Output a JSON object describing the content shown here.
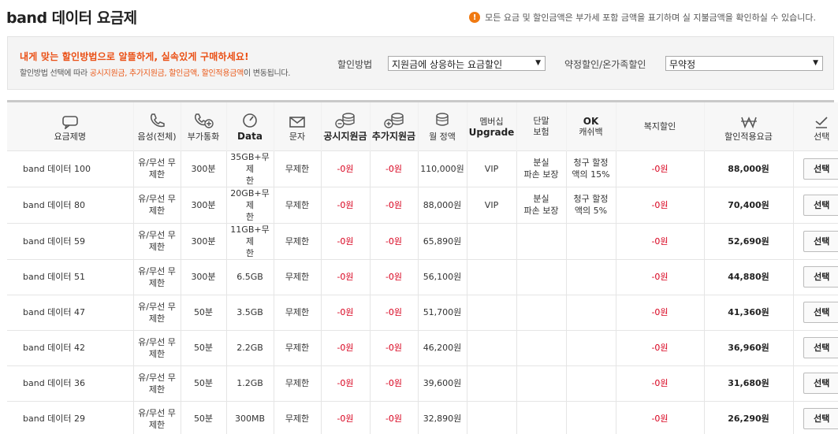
{
  "header": {
    "title": "band 데이터 요금제",
    "notice_icon": "!",
    "notice": "모든 요금 및 할인금액은 부가세 포함 금액을 표기하며 실 지불금액을 확인하실 수 있습니다."
  },
  "filter": {
    "headline": "내게 맞는 할인방법으로 알뜰하게, 실속있게 구매하세요!",
    "desc_prefix": "할인방법 선택에 따라 ",
    "desc_highlight": "공시지원금, 추가지원금, 할인금액, 할인적용금액",
    "desc_suffix": "이 변동됩니다.",
    "method_label": "할인방법",
    "method_value": "지원금에 상응하는 요금할인",
    "contract_label": "약정할인/온가족할인",
    "contract_value": "무약정"
  },
  "table": {
    "columns": {
      "plan": "요금제명",
      "voice": "음성(전체)",
      "extra_call": "부가통화",
      "data": "Data",
      "sms": "문자",
      "public_subsidy": "공시지원금",
      "extra_subsidy": "추가지원금",
      "monthly": "월 정액",
      "membership_1": "멤버십",
      "membership_2": "Upgrade",
      "insurance_1": "단말",
      "insurance_2": "보험",
      "ok_1": "OK",
      "ok_2": "캐쉬백",
      "welfare": "복지할인",
      "discount_price": "할인적용요금",
      "select": "선택"
    },
    "rows": [
      {
        "plan": "band 데이터 100",
        "voice_1": "유/무선 무",
        "voice_2": "제한",
        "extra": "300분",
        "data_1": "35GB+무제",
        "data_2": "한",
        "sms": "무제한",
        "public": "-0원",
        "extra_sub": "-0원",
        "monthly": "110,000원",
        "membership": "VIP",
        "ins_1": "분실",
        "ins_2": "파손 보장",
        "ok_1": "청구 할정",
        "ok_2": "액의 15%",
        "welfare": "-0원",
        "final": "88,000원",
        "btn": "선택"
      },
      {
        "plan": "band 데이터 80",
        "voice_1": "유/무선 무",
        "voice_2": "제한",
        "extra": "300분",
        "data_1": "20GB+무제",
        "data_2": "한",
        "sms": "무제한",
        "public": "-0원",
        "extra_sub": "-0원",
        "monthly": "88,000원",
        "membership": "VIP",
        "ins_1": "분실",
        "ins_2": "파손 보장",
        "ok_1": "청구 할정",
        "ok_2": "액의 5%",
        "welfare": "-0원",
        "final": "70,400원",
        "btn": "선택"
      },
      {
        "plan": "band 데이터 59",
        "voice_1": "유/무선 무",
        "voice_2": "제한",
        "extra": "300분",
        "data_1": "11GB+무제",
        "data_2": "한",
        "sms": "무제한",
        "public": "-0원",
        "extra_sub": "-0원",
        "monthly": "65,890원",
        "membership": "",
        "ins_1": "",
        "ins_2": "",
        "ok_1": "",
        "ok_2": "",
        "welfare": "-0원",
        "final": "52,690원",
        "btn": "선택"
      },
      {
        "plan": "band 데이터 51",
        "voice_1": "유/무선 무",
        "voice_2": "제한",
        "extra": "300분",
        "data_1": "6.5GB",
        "data_2": "",
        "sms": "무제한",
        "public": "-0원",
        "extra_sub": "-0원",
        "monthly": "56,100원",
        "membership": "",
        "ins_1": "",
        "ins_2": "",
        "ok_1": "",
        "ok_2": "",
        "welfare": "-0원",
        "final": "44,880원",
        "btn": "선택"
      },
      {
        "plan": "band 데이터 47",
        "voice_1": "유/무선 무",
        "voice_2": "제한",
        "extra": "50분",
        "data_1": "3.5GB",
        "data_2": "",
        "sms": "무제한",
        "public": "-0원",
        "extra_sub": "-0원",
        "monthly": "51,700원",
        "membership": "",
        "ins_1": "",
        "ins_2": "",
        "ok_1": "",
        "ok_2": "",
        "welfare": "-0원",
        "final": "41,360원",
        "btn": "선택"
      },
      {
        "plan": "band 데이터 42",
        "voice_1": "유/무선 무",
        "voice_2": "제한",
        "extra": "50분",
        "data_1": "2.2GB",
        "data_2": "",
        "sms": "무제한",
        "public": "-0원",
        "extra_sub": "-0원",
        "monthly": "46,200원",
        "membership": "",
        "ins_1": "",
        "ins_2": "",
        "ok_1": "",
        "ok_2": "",
        "welfare": "-0원",
        "final": "36,960원",
        "btn": "선택"
      },
      {
        "plan": "band 데이터 36",
        "voice_1": "유/무선 무",
        "voice_2": "제한",
        "extra": "50분",
        "data_1": "1.2GB",
        "data_2": "",
        "sms": "무제한",
        "public": "-0원",
        "extra_sub": "-0원",
        "monthly": "39,600원",
        "membership": "",
        "ins_1": "",
        "ins_2": "",
        "ok_1": "",
        "ok_2": "",
        "welfare": "-0원",
        "final": "31,680원",
        "btn": "선택"
      },
      {
        "plan": "band 데이터 29",
        "voice_1": "유/무선 무",
        "voice_2": "제한",
        "extra": "50분",
        "data_1": "300MB",
        "data_2": "",
        "sms": "무제한",
        "public": "-0원",
        "extra_sub": "-0원",
        "monthly": "32,890원",
        "membership": "",
        "ins_1": "",
        "ins_2": "",
        "ok_1": "",
        "ok_2": "",
        "welfare": "-0원",
        "final": "26,290원",
        "btn": "선택"
      }
    ]
  }
}
